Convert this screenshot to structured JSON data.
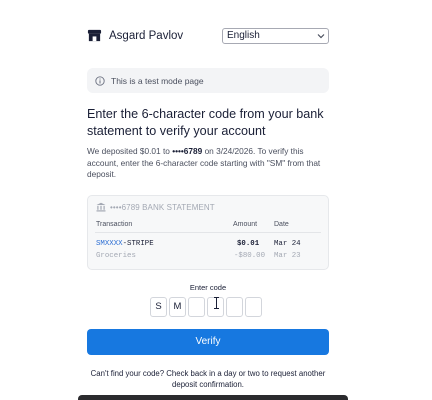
{
  "header": {
    "brand_name": "Asgard Pavlov",
    "language_selected": "English"
  },
  "banner": {
    "text": "This is a test mode page"
  },
  "main": {
    "title": "Enter the 6-character code from your bank statement to verify your account",
    "desc_part1": "We deposited $0.01 to ",
    "desc_account": "••••6789",
    "desc_part2": " on 3/24/2026. To verify this account, enter the 6-character code starting with \"SM\" from that deposit."
  },
  "statement": {
    "header": "••••6789 BANK STATEMENT",
    "columns": {
      "transaction": "Transaction",
      "amount": "Amount",
      "date": "Date"
    },
    "rows": [
      {
        "tx_highlight": "SMXXXX",
        "tx_rest": "-STRIPE",
        "amount": "$0.01",
        "date": "Mar 24"
      },
      {
        "tx_highlight": "",
        "tx_rest": "Groceries",
        "amount": "-$80.00",
        "date": "Mar 23"
      }
    ]
  },
  "code_entry": {
    "label": "Enter code",
    "chars": [
      "S",
      "M",
      "",
      "",
      "",
      ""
    ]
  },
  "actions": {
    "verify_label": "Verify"
  },
  "help": {
    "text": "Can't find your code? Check back in a day or two to request another deposit confirmation."
  },
  "colors": {
    "accent": "#1778e0",
    "code_highlight": "#2d6fd4"
  }
}
